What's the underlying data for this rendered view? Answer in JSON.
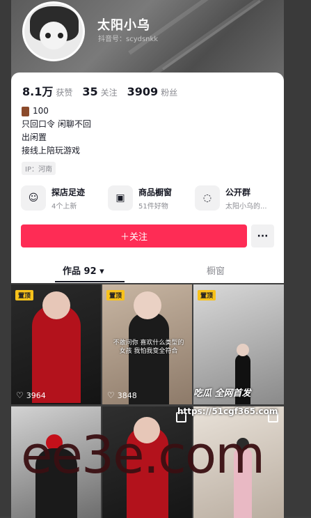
{
  "profile": {
    "nickname": "太阳小乌",
    "uid": "抖音号：scydsnkk"
  },
  "stats": {
    "likes_num": "8.1万",
    "likes_label": "获赞",
    "following_num": "35",
    "following_label": "关注",
    "followers_num": "3909",
    "followers_label": "粉丝"
  },
  "bio": {
    "line1": "100",
    "line2": "只回口令 闲聊不回",
    "line3": "出闲置",
    "line4": "接线上陪玩游戏"
  },
  "ip": "IP：河南",
  "features": [
    {
      "icon": "shop-visit-icon",
      "title": "探店足迹",
      "sub": "4个上新"
    },
    {
      "icon": "showcase-icon",
      "title": "商品橱窗",
      "sub": "51件好物"
    },
    {
      "icon": "group-chat-icon",
      "title": "公开群",
      "sub": "太阳小乌的..."
    }
  ],
  "actions": {
    "follow": "＋关注",
    "more": "···"
  },
  "tabs": {
    "works": "作品 92 ▾",
    "showcase": "橱窗"
  },
  "videos": [
    {
      "pinned": "置顶",
      "likes": "3964",
      "caption": ""
    },
    {
      "pinned": "置顶",
      "likes": "3848",
      "caption": "不敢问你 喜欢什么类型的女孩 我怕我变全符合"
    },
    {
      "pinned": "置顶",
      "likes": "",
      "caption": ""
    },
    {
      "pinned": "",
      "likes": "",
      "caption": ""
    },
    {
      "pinned": "",
      "likes": "",
      "caption": ""
    },
    {
      "pinned": "",
      "likes": "",
      "caption": ""
    }
  ],
  "watermarks": {
    "logo": "吃瓜 全网首发",
    "url": "https://51cgf365.com",
    "big": "ee3e.com"
  },
  "colors": {
    "accent": "#fe2c55",
    "pin": "#f8c21b"
  }
}
